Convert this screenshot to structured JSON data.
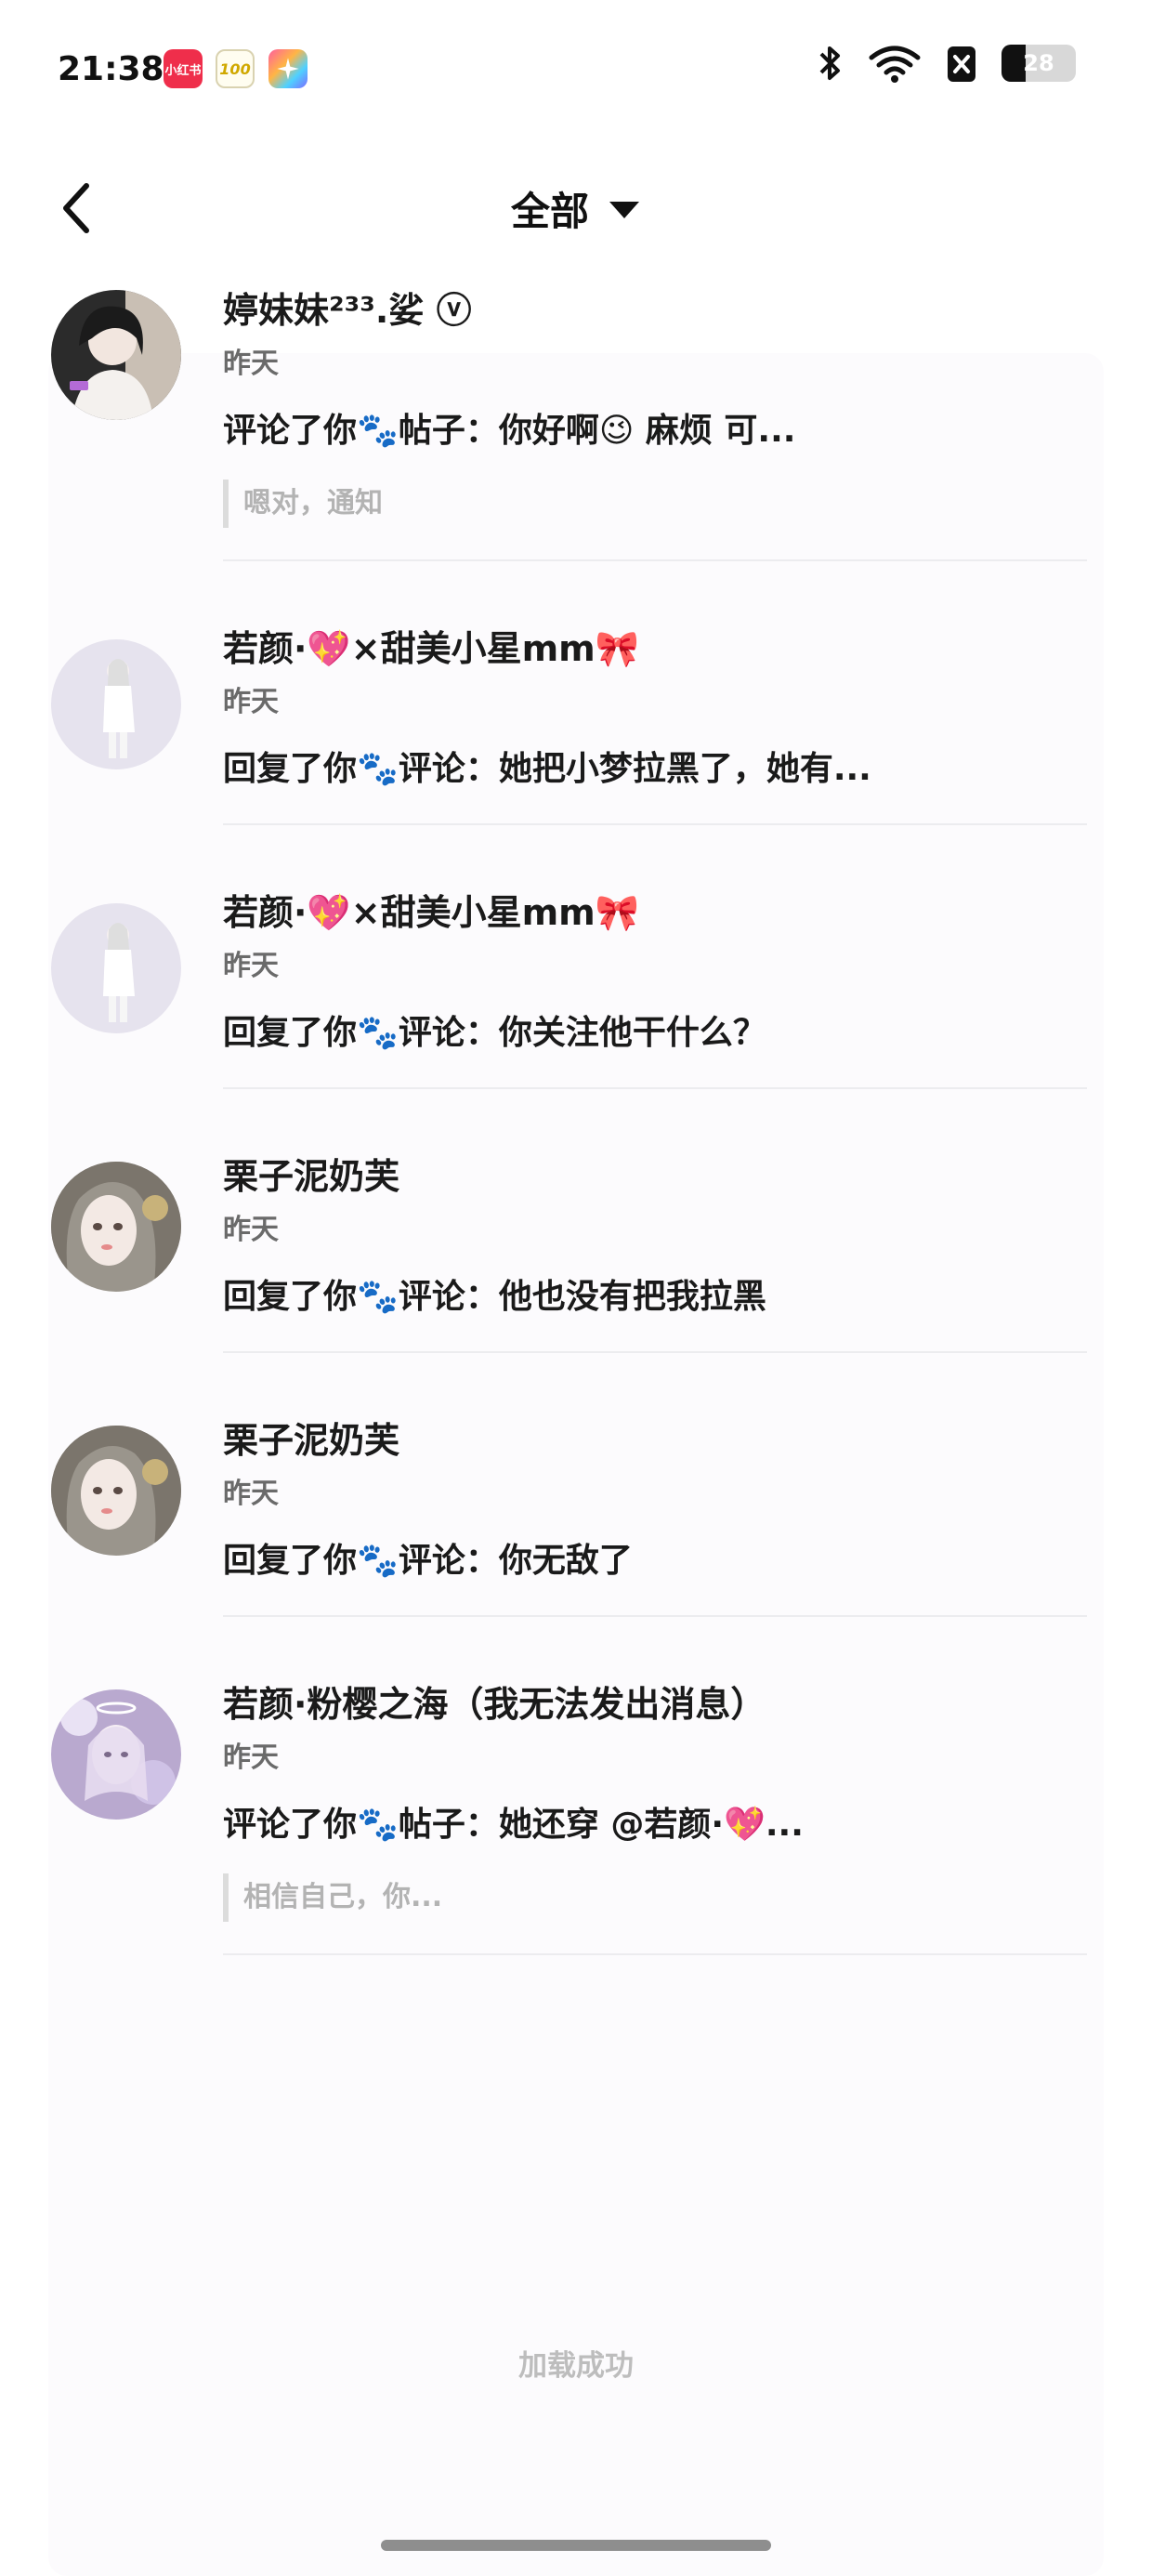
{
  "status_bar": {
    "time": "21:38",
    "apps": [
      "小红书",
      "100"
    ],
    "battery": "28"
  },
  "header": {
    "title": "全部"
  },
  "notifications": [
    {
      "username": "婷妹妹²³³.娑 ⓥ",
      "time": "昨天",
      "action": "评论了你🐾帖子：你好啊😉 麻烦 可...",
      "quote": "嗯对，通知"
    },
    {
      "username": "若颜·💖×甜美小星mm🎀",
      "time": "昨天",
      "action": "回复了你🐾评论：她把小梦拉黑了，她有..."
    },
    {
      "username": "若颜·💖×甜美小星mm🎀",
      "time": "昨天",
      "action": "回复了你🐾评论：你关注他干什么？"
    },
    {
      "username": "栗子泥奶芙",
      "time": "昨天",
      "action": "回复了你🐾评论：他也没有把我拉黑"
    },
    {
      "username": "栗子泥奶芙",
      "time": "昨天",
      "action": "回复了你🐾评论：你无敌了"
    },
    {
      "username": "若颜·粉樱之海（我无法发出消息）",
      "time": "昨天",
      "action": "评论了你🐾帖子：她还穿 @若颜·💖...",
      "quote": "相信自己，你..."
    }
  ],
  "footer": {
    "status": "加载成功"
  },
  "colors": {
    "text": "#1a1a1a",
    "secondary": "#6a6a6a",
    "muted": "#b3b3b3",
    "divider": "#ececef"
  }
}
